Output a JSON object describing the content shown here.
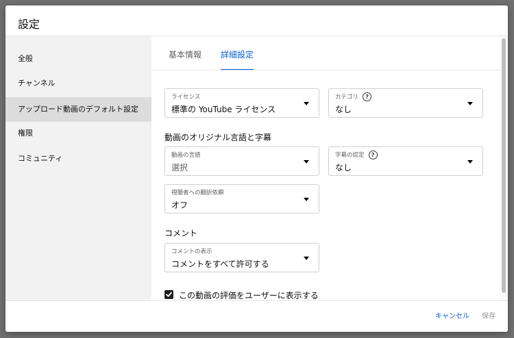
{
  "dialog": {
    "title": "設定"
  },
  "sidebar": {
    "items": [
      {
        "label": "全般"
      },
      {
        "label": "チャンネル"
      },
      {
        "label": "アップロード動画のデフォルト設定",
        "active": true
      },
      {
        "label": "権限"
      },
      {
        "label": "コミュニティ"
      }
    ]
  },
  "tabs": [
    {
      "label": "基本情報",
      "active": false
    },
    {
      "label": "詳細設定",
      "active": true
    }
  ],
  "fields": {
    "license": {
      "label": "ライセンス",
      "value": "標準の YouTube ライセンス"
    },
    "category": {
      "label": "カテゴリ",
      "value": "なし"
    },
    "video_language": {
      "label": "動画の言語",
      "value": "選択"
    },
    "caption_cert": {
      "label": "字幕の認定",
      "value": "なし"
    },
    "translation_request": {
      "label": "視聴者への翻訳依頼",
      "value": "オフ"
    },
    "comment_display": {
      "label": "コメントの表示",
      "value": "コメントをすべて許可する"
    }
  },
  "sections": {
    "language_captions": "動画のオリジナル言語と字幕",
    "comments": "コメント"
  },
  "ratings_checkbox": {
    "label": "この動画の評価をユーザーに表示する",
    "checked": true
  },
  "footer": {
    "cancel_label": "キャンセル",
    "save_label": "保存"
  },
  "colors": {
    "accent": "#065fd4",
    "sidebar_bg": "#f2f2f2",
    "active_item_bg": "#dcdcdc"
  }
}
